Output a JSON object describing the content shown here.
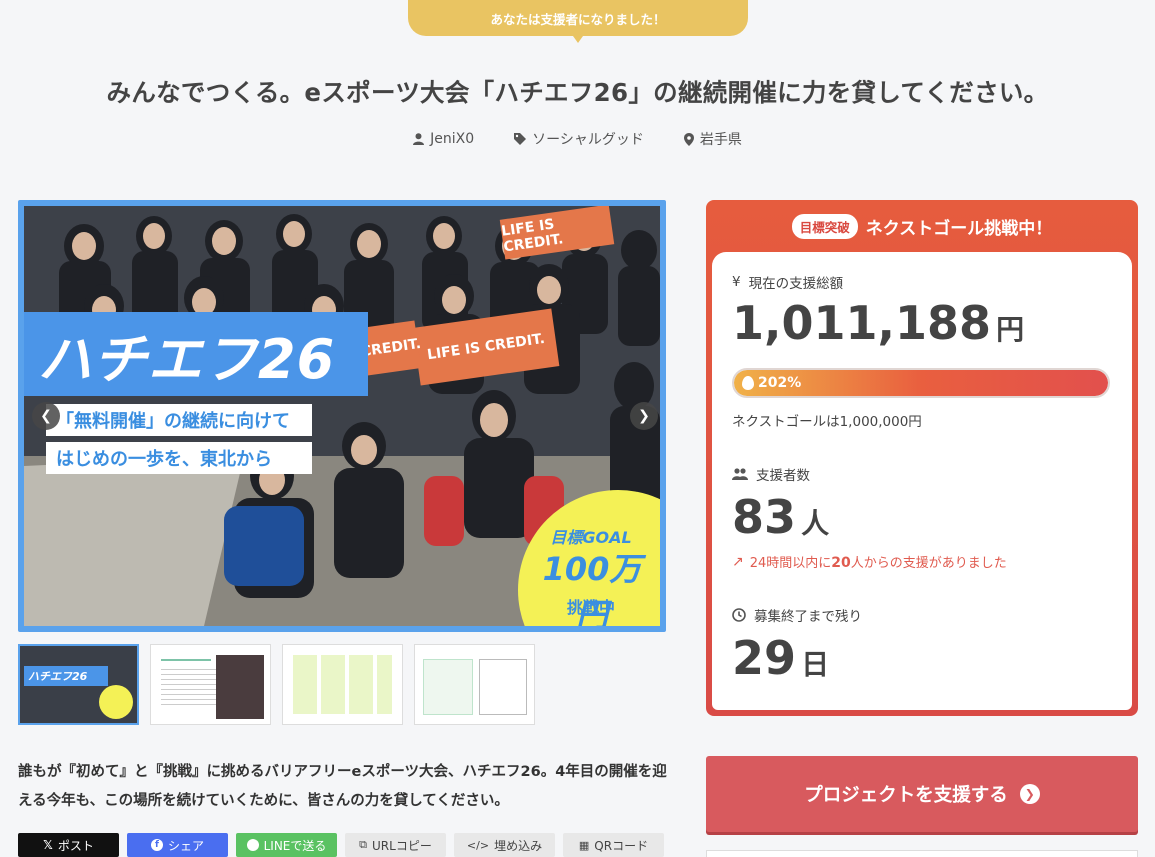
{
  "banner": {
    "text": "あなたは支援者になりました！"
  },
  "project": {
    "title": "みんなでつくる。eスポーツ大会「ハチエフ26」の継続開催に力を貸してください。",
    "author": "JeniX0",
    "category": "ソーシャルグッド",
    "location": "岩手県"
  },
  "hero": {
    "logo": "ハチエフ26",
    "caption_line1": "「無料開催」の継続に向けて",
    "caption_line2": "はじめの一歩を、東北から",
    "goal_line1": "目標GOAL",
    "goal_line2": "100万円",
    "goal_line3": "挑戦中",
    "banner_text_1": "LIFE IS CREDIT.",
    "banner_text_2": "LIFE IS CREDIT.",
    "banner_text_3": "CREDIT.",
    "prev_icon": "chevron-left-icon",
    "next_icon": "chevron-right-icon"
  },
  "thumbnails": [
    {
      "label": "ハチエフ26"
    },
    {
      "label": ""
    },
    {
      "label": ""
    },
    {
      "label": ""
    }
  ],
  "description": "誰もが『初めて』と『挑戦』に挑めるバリアフリーeスポーツ大会、ハチエフ26。4年目の開催を迎える今年も、この場所を続けていくために、皆さんの力を貸してください。",
  "share": {
    "post": "ポスト",
    "share": "シェア",
    "line": "LINEで送る",
    "url_copy": "URLコピー",
    "embed": "埋め込み",
    "qr": "QRコード"
  },
  "panel": {
    "badge": "目標突破",
    "heading": "ネクストゴール挑戦中！",
    "total_label": "現在の支援総額",
    "total_amount": "1,011,188",
    "total_unit": "円",
    "progress_percent": "202%",
    "progress_value": 2.02,
    "next_goal": "ネクストゴールは1,000,000円",
    "supporters_label": "支援者数",
    "supporters_count": "83",
    "supporters_unit": "人",
    "trend_prefix": "24時間以内に",
    "trend_count": "20",
    "trend_suffix": "人からの支援がありました",
    "remaining_label": "募集終了まで残り",
    "remaining_days": "29",
    "remaining_unit": "日"
  },
  "cta": {
    "label": "プロジェクトを支援する"
  },
  "colors": {
    "accent": "#e2504d",
    "banner": "#e9c462",
    "brand_blue": "#5aa2ec",
    "cta": "#d85a5e"
  }
}
